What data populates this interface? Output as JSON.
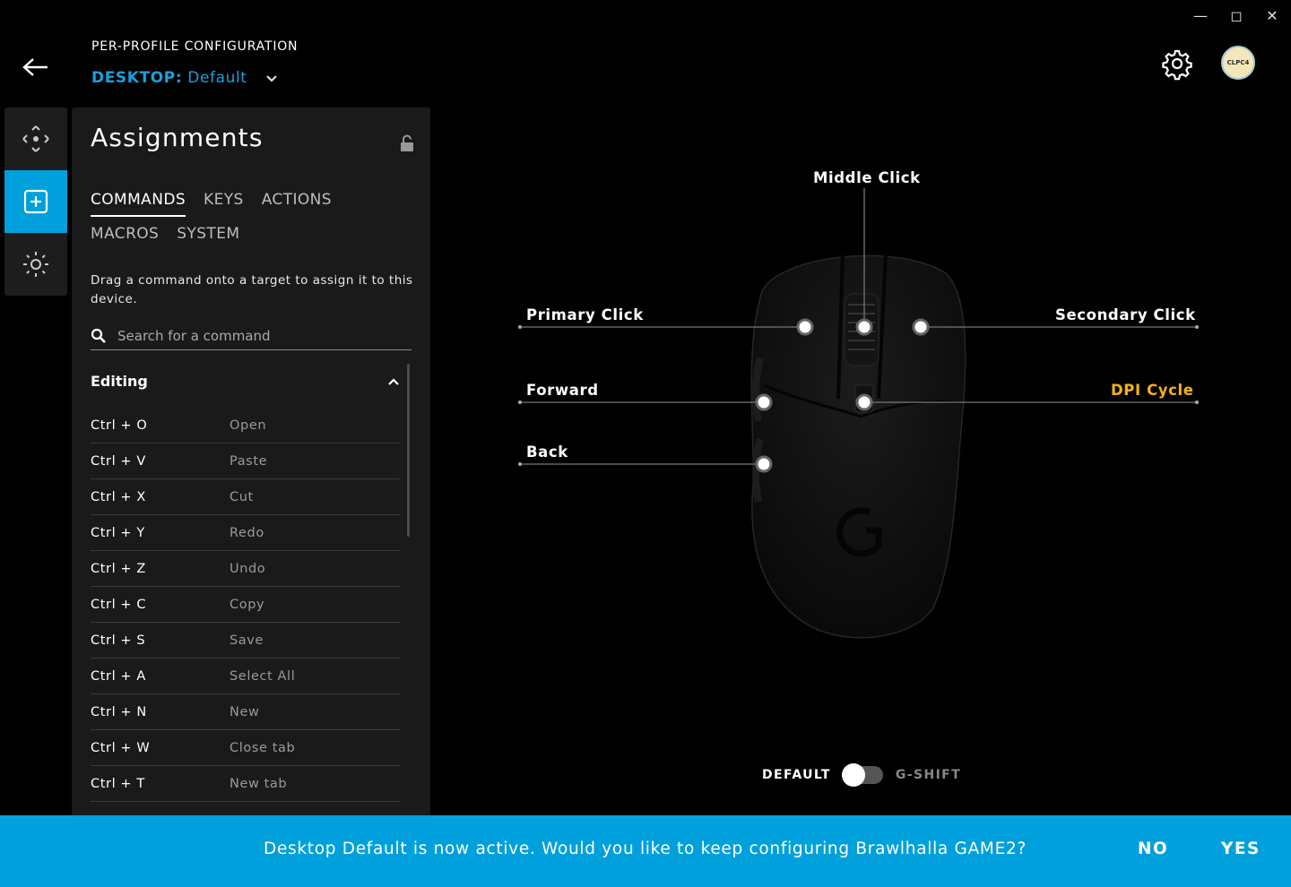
{
  "window": {
    "minimize_icon": "minimize-icon",
    "maximize_icon": "maximize-icon",
    "close_icon": "close-icon"
  },
  "header": {
    "title": "PER-PROFILE CONFIGURATION",
    "device": "DESKTOP:",
    "profile": "Default",
    "avatar_text": "CLPC4"
  },
  "rail": {
    "items": [
      "move-icon",
      "assignments-icon",
      "lighting-icon"
    ],
    "active": 1
  },
  "assignments": {
    "title": "Assignments",
    "tabs_row1": [
      "COMMANDS",
      "KEYS",
      "ACTIONS"
    ],
    "tabs_row2": [
      "MACROS",
      "SYSTEM"
    ],
    "active_tab": "COMMANDS",
    "hint": "Drag a command onto a target to assign it to this device.",
    "search_placeholder": "Search for a command",
    "section": "Editing",
    "commands": [
      {
        "key": "Ctrl + O",
        "action": "Open"
      },
      {
        "key": "Ctrl + V",
        "action": "Paste"
      },
      {
        "key": "Ctrl + X",
        "action": "Cut"
      },
      {
        "key": "Ctrl + Y",
        "action": "Redo"
      },
      {
        "key": "Ctrl + Z",
        "action": "Undo"
      },
      {
        "key": "Ctrl + C",
        "action": "Copy"
      },
      {
        "key": "Ctrl + S",
        "action": "Save"
      },
      {
        "key": "Ctrl + A",
        "action": "Select All"
      },
      {
        "key": "Ctrl + N",
        "action": "New"
      },
      {
        "key": "Ctrl + W",
        "action": "Close tab"
      },
      {
        "key": "Ctrl + T",
        "action": "New tab"
      }
    ]
  },
  "mouse": {
    "labels": {
      "middle": "Middle Click",
      "primary": "Primary Click",
      "secondary": "Secondary Click",
      "forward": "Forward",
      "back": "Back",
      "dpi": "DPI Cycle"
    },
    "highlight_color": "#f5b21a"
  },
  "mode_toggle": {
    "left": "DEFAULT",
    "right": "G-SHIFT",
    "on": false
  },
  "banner": {
    "message": "Desktop Default is now active. Would you like to keep configuring Brawlhalla GAME2?",
    "no": "NO",
    "yes": "YES",
    "color": "#00a0dc"
  }
}
